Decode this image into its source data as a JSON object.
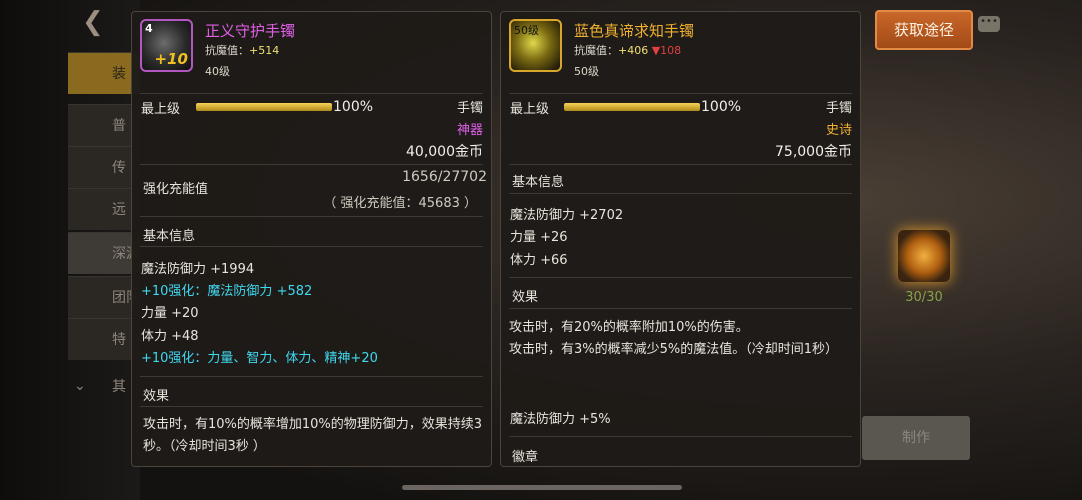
{
  "background": {
    "tabs": [
      "装",
      "普",
      "传",
      "远",
      "深渊",
      "团队",
      "特",
      "其"
    ],
    "crafted_count": "30/30",
    "make_button_label": "制作",
    "source_button_label": "获取途径"
  },
  "left": {
    "icon_level": "4",
    "icon_plus": "+10",
    "name": "正义守护手镯",
    "resist_label": "抗魔值：",
    "resist_value": "+514",
    "level": "40级",
    "max_label": "最上级",
    "progress_pct": "100%",
    "progress_fraction": 1.0,
    "slot": "手镯",
    "tier": "神器",
    "price": "40,000金币",
    "enhance_label": "强化充能值",
    "enhance_progress": "1656/27702",
    "enhance_total": "（ 强化充能值：45683 ）",
    "basic_title": "基本信息",
    "basic_lines": [
      {
        "text": "魔法防御力 +1994",
        "highlight": false
      },
      {
        "text": "+10强化：魔法防御力 +582",
        "highlight": true
      },
      {
        "text": "力量 +20",
        "highlight": false
      },
      {
        "text": "体力 +48",
        "highlight": false
      },
      {
        "text": "+10强化：力量、智力、体力、精神+20",
        "highlight": true
      }
    ],
    "effect_title": "效果",
    "effect_text": "攻击时，有10%的概率增加10%的物理防御力，效果持续3秒。（冷却时间3秒 ）",
    "colors": {
      "name": "#e060e8",
      "highlight": "#40d8f0"
    }
  },
  "right": {
    "icon_level": "50级",
    "name": "蓝色真谛求知手镯",
    "resist_label": "抗魔值：",
    "resist_value": "+406",
    "resist_delta": "▼108",
    "level": "50级",
    "max_label": "最上级",
    "progress_pct": "100%",
    "progress_fraction": 1.0,
    "slot": "手镯",
    "tier": "史诗",
    "price": "75,000金币",
    "basic_title": "基本信息",
    "basic_lines": [
      "魔法防御力 +2702",
      "力量 +26",
      "体力 +66"
    ],
    "effect_title": "效果",
    "effect_lines": [
      "攻击时，有20%的概率附加10%的伤害。",
      "攻击时，有3%的概率减少5%的魔法值。（冷却时间1秒）"
    ],
    "magic_line": "魔法防御力 +5%",
    "badge_title": "徽章",
    "colors": {
      "name": "#f0b030",
      "down": "#e04040"
    }
  }
}
